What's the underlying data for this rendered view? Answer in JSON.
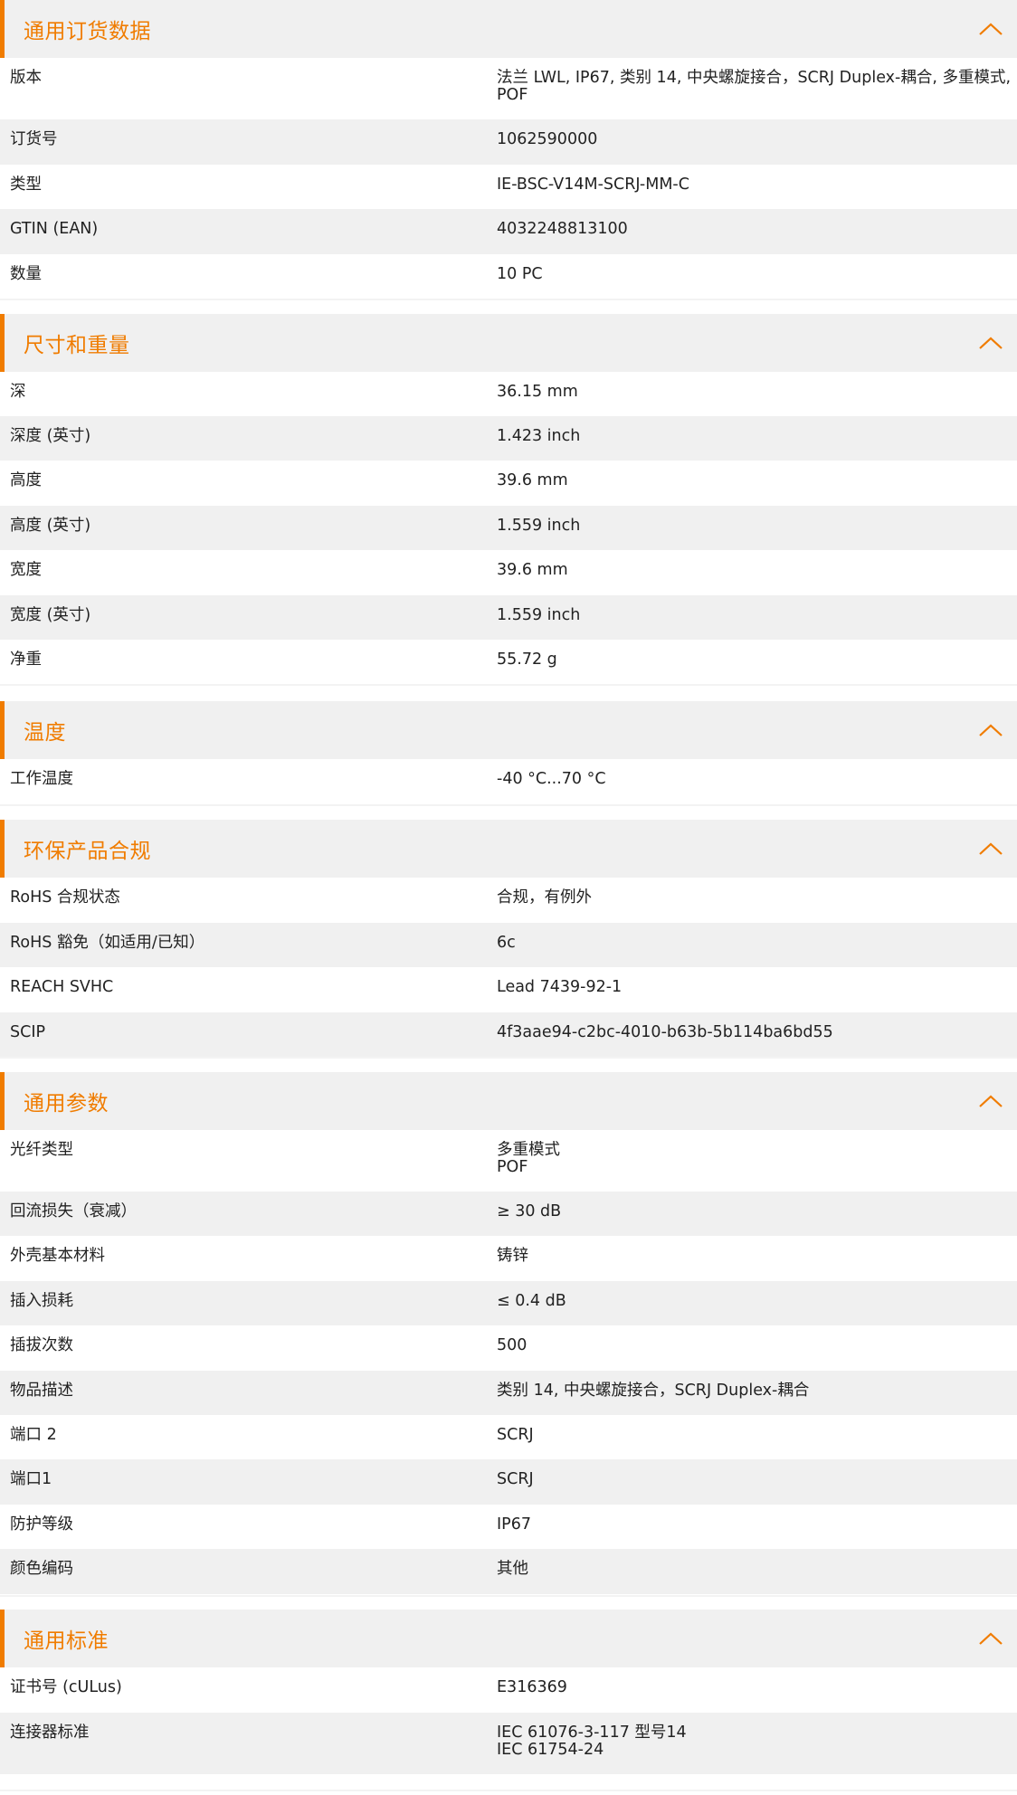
{
  "accent_color": "#f07c00",
  "collapse_icon": "chevron-up-icon",
  "sections": [
    {
      "title": "通用订货数据",
      "rows": [
        {
          "label": "版本",
          "value": "法兰 LWL, IP67, 类别 14, 中央螺旋接合，SCRJ Duplex-耦合, 多重模式,\nPOF"
        },
        {
          "label": "订货号",
          "value": "1062590000"
        },
        {
          "label": "类型",
          "value": "IE-BSC-V14M-SCRJ-MM-C"
        },
        {
          "label": "GTIN (EAN)",
          "value": "4032248813100"
        },
        {
          "label": "数量",
          "value": "10  PC"
        }
      ]
    },
    {
      "title": "尺寸和重量",
      "rows": [
        {
          "label": "深",
          "value": "36.15  mm"
        },
        {
          "label": "深度 (英寸)",
          "value": "1.423  inch"
        },
        {
          "label": "高度",
          "value": "39.6  mm"
        },
        {
          "label": "高度 (英寸)",
          "value": "1.559  inch"
        },
        {
          "label": "宽度",
          "value": "39.6  mm"
        },
        {
          "label": "宽度 (英寸)",
          "value": "1.559  inch"
        },
        {
          "label": "净重",
          "value": "55.72  g"
        }
      ]
    },
    {
      "title": "温度",
      "rows": [
        {
          "label": "工作温度",
          "value": "-40 °C...70 °C"
        }
      ]
    },
    {
      "title": "环保产品合规",
      "rows": [
        {
          "label": "RoHS 合规状态",
          "value": "合规，有例外"
        },
        {
          "label": "RoHS 豁免（如适用/已知）",
          "value": "6c"
        },
        {
          "label": "REACH SVHC",
          "value": "Lead 7439-92-1"
        },
        {
          "label": "SCIP",
          "value": "4f3aae94-c2bc-4010-b63b-5b114ba6bd55"
        }
      ]
    },
    {
      "title": "通用参数",
      "rows": [
        {
          "label": "光纤类型",
          "value": "多重模式\nPOF"
        },
        {
          "label": "回流损失（衰减）",
          "value": "≥ 30 dB"
        },
        {
          "label": "外壳基本材料",
          "value": "铸锌"
        },
        {
          "label": "插入损耗",
          "value": "≤ 0.4 dB"
        },
        {
          "label": "插拔次数",
          "value": "500"
        },
        {
          "label": "物品描述",
          "value": "类别 14, 中央螺旋接合，SCRJ Duplex-耦合"
        },
        {
          "label": "端口 2",
          "value": "SCRJ"
        },
        {
          "label": "端口1",
          "value": "SCRJ"
        },
        {
          "label": "防护等级",
          "value": "IP67"
        },
        {
          "label": "颜色编码",
          "value": "其他"
        }
      ]
    },
    {
      "title": "通用标准",
      "rows": [
        {
          "label": "证书号 (cULus)",
          "value": "E316369"
        },
        {
          "label": "连接器标准",
          "value": "IEC 61076-3-117 型号14\nIEC 61754-24"
        }
      ]
    }
  ]
}
